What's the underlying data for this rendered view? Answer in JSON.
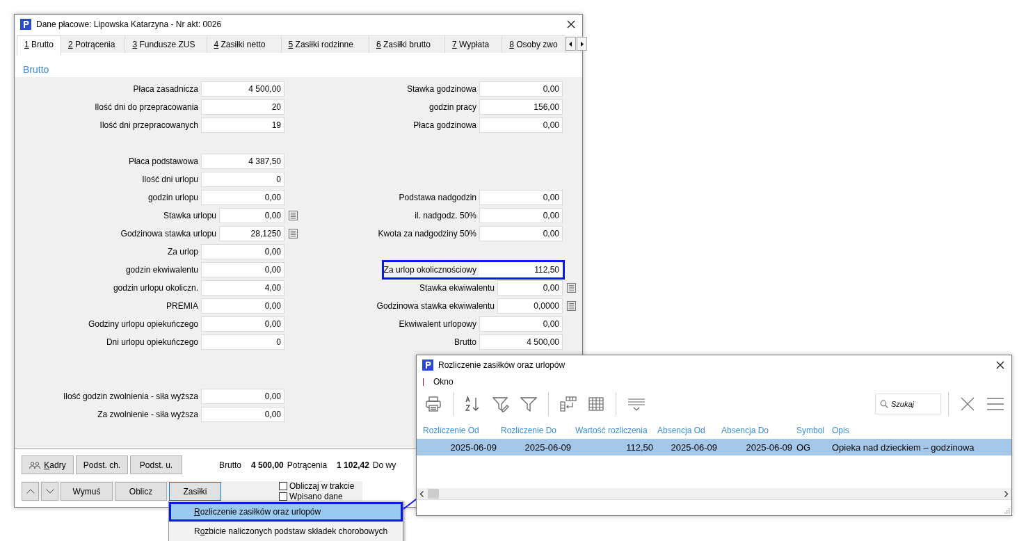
{
  "window": {
    "title": "Dane płacowe: Lipowska Katarzyna - Nr akt: 0026"
  },
  "tabs": [
    {
      "key": "1",
      "post": " Brutto",
      "selected": true
    },
    {
      "key": "2",
      "post": " Potrącenia",
      "selected": false
    },
    {
      "key": "3",
      "post": " Fundusze ZUS",
      "selected": false
    },
    {
      "key": "4",
      "post": " Zasiłki netto",
      "selected": false
    },
    {
      "key": "5",
      "post": " Zasiłki rodzinne",
      "selected": false
    },
    {
      "key": "6",
      "post": " Zasiłki brutto",
      "selected": false
    },
    {
      "key": "7",
      "post": " Wypłata",
      "selected": false
    },
    {
      "key": "8",
      "post": " Osoby zwo",
      "selected": false
    }
  ],
  "section_title": "Brutto",
  "form": {
    "rows": [
      {
        "left": {
          "label": "Płaca zasadnicza",
          "value": "4 500,00",
          "calc": false,
          "highlighted": false
        },
        "right": {
          "label": "Stawka godzinowa",
          "value": "0,00",
          "calc": false,
          "highlighted": false
        }
      },
      {
        "left": {
          "label": "Ilość dni do przepracowania",
          "value": "20",
          "calc": false,
          "highlighted": false
        },
        "right": {
          "label": "godzin pracy",
          "value": "156,00",
          "calc": false,
          "highlighted": false
        }
      },
      {
        "left": {
          "label": "Ilość dni przepracowanych",
          "value": "19",
          "calc": false,
          "highlighted": false
        },
        "right": {
          "label": "Płaca godzinowa",
          "value": "0,00",
          "calc": false,
          "highlighted": false
        }
      },
      {},
      {
        "left": {
          "label": "Płaca podstawowa",
          "value": "4 387,50",
          "calc": false,
          "highlighted": false
        }
      },
      {
        "left": {
          "label": "Ilość dni urlopu",
          "value": "0",
          "calc": false,
          "highlighted": false
        }
      },
      {
        "left": {
          "label": "godzin urlopu",
          "value": "0,00",
          "calc": false,
          "highlighted": false
        },
        "right": {
          "label": "Podstawa nadgodzin",
          "value": "0,00",
          "calc": false,
          "highlighted": false
        }
      },
      {
        "left": {
          "label": "Stawka urlopu",
          "value": "0,00",
          "calc": true,
          "highlighted": false
        },
        "right": {
          "label": "il. nadgodz. 50%",
          "value": "0,00",
          "calc": false,
          "highlighted": false
        }
      },
      {
        "left": {
          "label": "Godzinowa stawka urlopu",
          "value": "28,1250",
          "calc": true,
          "highlighted": false
        },
        "right": {
          "label": "Kwota za nadgodziny 50%",
          "value": "0,00",
          "calc": false,
          "highlighted": false
        }
      },
      {
        "left": {
          "label": "Za urlop",
          "value": "0,00",
          "calc": false,
          "highlighted": false
        }
      },
      {
        "left": {
          "label": "godzin ekwiwalentu",
          "value": "0,00",
          "calc": false,
          "highlighted": false
        },
        "right": {
          "label": "Za urlop okolicznościowy",
          "value": "112,50",
          "calc": false,
          "highlighted": true
        }
      },
      {
        "left": {
          "label": "godzin urlopu okoliczn.",
          "value": "4,00",
          "calc": false,
          "highlighted": false
        },
        "right": {
          "label": "Stawka ekwiwalentu",
          "value": "0,00",
          "calc": true,
          "highlighted": false
        }
      },
      {
        "left": {
          "label": "PREMIA",
          "value": "0,00",
          "calc": false,
          "highlighted": false
        },
        "right": {
          "label": "Godzinowa stawka ekwiwalentu",
          "value": "0,0000",
          "calc": true,
          "highlighted": false
        }
      },
      {
        "left": {
          "label": "Godziny urlopu opiekuńczego",
          "value": "0,00",
          "calc": false,
          "highlighted": false
        },
        "right": {
          "label": "Ekwiwalent urlopowy",
          "value": "0,00",
          "calc": false,
          "highlighted": false
        }
      },
      {
        "left": {
          "label": "Dni urlopu opiekuńczego",
          "value": "0",
          "calc": false,
          "highlighted": false
        },
        "right": {
          "label": "Brutto",
          "value": "4 500,00",
          "calc": false,
          "highlighted": false
        }
      },
      {},
      {},
      {
        "left": {
          "label": "Ilość godzin zwolnienia - siła wyższa",
          "value": "0,00",
          "calc": false,
          "highlighted": false
        }
      },
      {
        "left": {
          "label": "Za zwolnienie - siła wyższa",
          "value": "0,00",
          "calc": false,
          "highlighted": false
        }
      }
    ]
  },
  "buttons_top": [
    {
      "key": "K",
      "post": "adry",
      "kind": "people"
    },
    {
      "post": "Podst. ch.",
      "kind": "plain"
    },
    {
      "post": "Podst. u.",
      "kind": "plain"
    }
  ],
  "summary": [
    {
      "label": "Brutto",
      "value": "4 500,00"
    },
    {
      "label": "Potrącenia",
      "value": "1 102,42"
    },
    {
      "label": "Do wy"
    }
  ],
  "buttons_bottom": [
    {
      "label": "Wymuś",
      "selected": false
    },
    {
      "label": "Oblicz",
      "selected": false
    },
    {
      "label": "Zasiłki",
      "selected": true
    }
  ],
  "checkboxes": [
    {
      "label": "Obliczaj w trakcie",
      "checked": false
    },
    {
      "label": "Wpisano dane",
      "checked": false
    }
  ],
  "dropdown": {
    "items": [
      {
        "key": "R",
        "post": "ozliczenie zasiłków oraz urlopów",
        "selected": true
      },
      {
        "pre": "R",
        "key": "o",
        "post": "zbicie naliczonych podstaw składek chorobowych",
        "selected": false
      }
    ]
  },
  "dialog": {
    "title": "Rozliczenie zasiłków oraz urlopów",
    "menu": [
      "Okno"
    ],
    "search": {
      "placeholder": "Szukaj"
    },
    "table": {
      "columns": [
        "Rozliczenie Od",
        "Rozliczenie Do",
        "Wartość rozliczenia",
        "Absencja Od",
        "Absencja Do",
        "Symbol",
        "Opis"
      ],
      "rows": [
        {
          "cells": [
            "2025-06-09",
            "2025-06-09",
            "112,50",
            "2025-06-09",
            "2025-06-09",
            "OG",
            "Opieka nad dzieckiem – godzinowa"
          ],
          "selected": true
        }
      ]
    }
  }
}
